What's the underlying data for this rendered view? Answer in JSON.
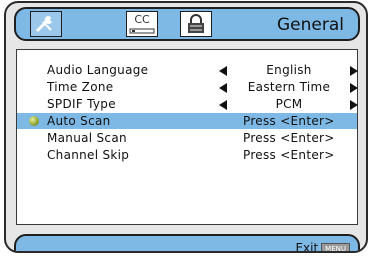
{
  "header": {
    "title": "General",
    "tabs": [
      {
        "name": "tab-general",
        "icon": "wrench-icon"
      },
      {
        "name": "tab-cc",
        "label": "CC",
        "icon": "cc-icon"
      },
      {
        "name": "tab-lock",
        "icon": "lock-icon"
      }
    ]
  },
  "menu": {
    "items": [
      {
        "label": "Audio Language",
        "value": "English",
        "arrows": true
      },
      {
        "label": "Time Zone",
        "value": "Eastern Time",
        "arrows": true
      },
      {
        "label": "SPDIF Type",
        "value": "PCM",
        "arrows": true
      },
      {
        "label": "Auto Scan",
        "value": "Press <Enter>",
        "selected": true
      },
      {
        "label": "Manual Scan",
        "value": "Press <Enter>"
      },
      {
        "label": "Channel Skip",
        "value": "Press <Enter>"
      }
    ]
  },
  "footer": {
    "exit_label": "Exit",
    "menu_badge": "MENU"
  },
  "colors": {
    "bar": "#7eb9e6",
    "selected_row": "#7eb9e6",
    "frame": "#e6e6e6"
  }
}
